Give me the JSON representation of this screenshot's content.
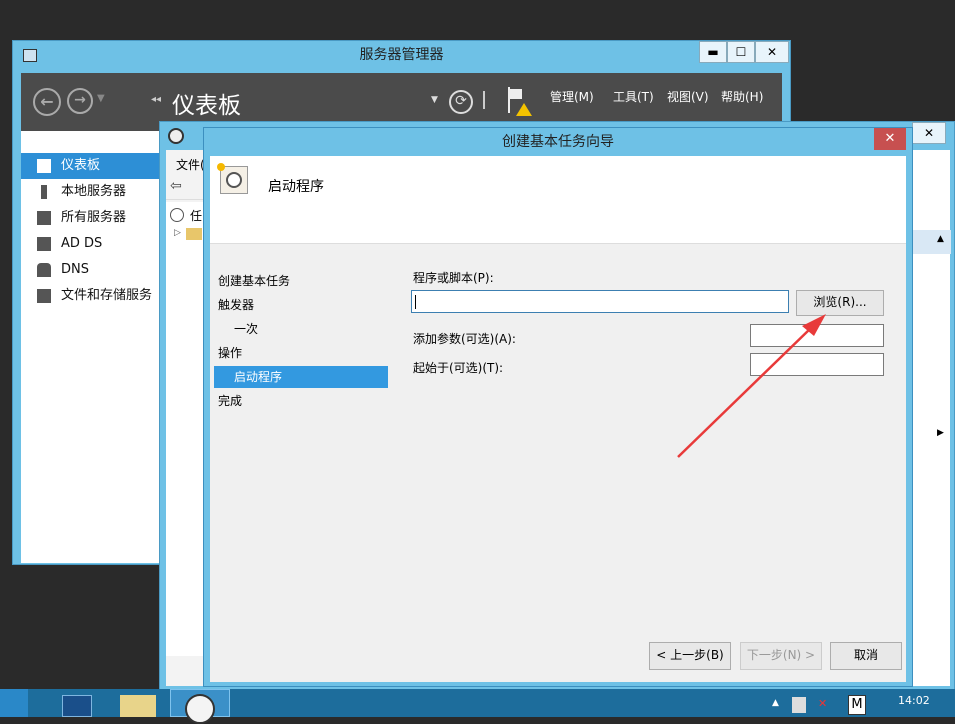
{
  "server_manager": {
    "title": "服务器管理器",
    "page_title": "仪表板",
    "min": "▬",
    "max": "☐",
    "close": "✕",
    "menus": [
      "管理(M)",
      "工具(T)",
      "视图(V)",
      "帮助(H)"
    ],
    "nav": [
      {
        "label": "仪表板",
        "selected": true
      },
      {
        "label": "本地服务器"
      },
      {
        "label": "所有服务器"
      },
      {
        "label": "AD DS"
      },
      {
        "label": "DNS"
      },
      {
        "label": "文件和存储服务"
      }
    ]
  },
  "task_scheduler": {
    "menu_file": "文件(",
    "tree_root": "任",
    "close": "✕"
  },
  "wizard": {
    "title": "创建基本任务向导",
    "close": "✕",
    "header_title": "启动程序",
    "steps": [
      {
        "label": "创建基本任务",
        "indent": false
      },
      {
        "label": "触发器",
        "indent": false
      },
      {
        "label": "一次",
        "indent": true
      },
      {
        "label": "操作",
        "indent": false
      },
      {
        "label": "启动程序",
        "indent": true,
        "selected": true
      },
      {
        "label": "完成",
        "indent": false
      }
    ],
    "program_label": "程序或脚本(P):",
    "program_value": "",
    "browse": "浏览(R)...",
    "args_label": "添加参数(可选)(A):",
    "args_value": "",
    "start_in_label": "起始于(可选)(T):",
    "start_in_value": "",
    "back": "< 上一步(B)",
    "next": "下一步(N) >",
    "cancel": "取消"
  },
  "taskbar": {
    "time": "14:02",
    "ime": "M",
    "arrow": "▲"
  },
  "colors": {
    "window_frame": "#6ec1e6",
    "selection": "#2d8fd6",
    "annotation_arrow": "#e83a3a"
  }
}
